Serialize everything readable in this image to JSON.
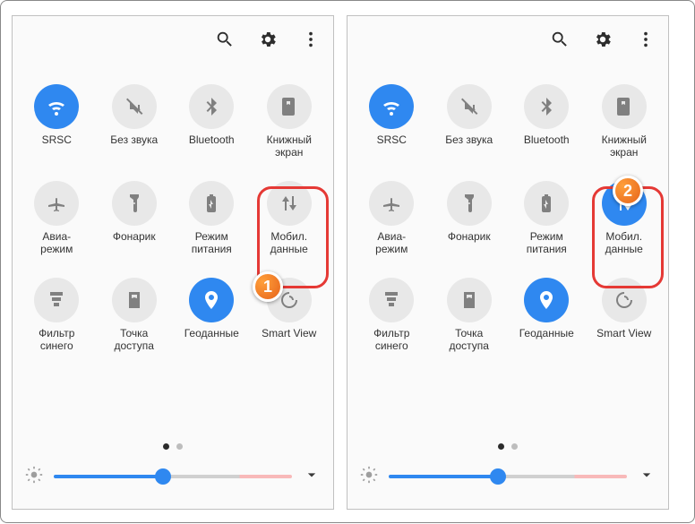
{
  "badges": {
    "left": "1",
    "right": "2"
  },
  "screens": [
    {
      "tiles": [
        {
          "name": "wifi",
          "label": "SRSC",
          "icon": "wifi",
          "on": true
        },
        {
          "name": "mute",
          "label": "Без звука",
          "icon": "mute",
          "on": false
        },
        {
          "name": "bluetooth",
          "label": "Bluetooth",
          "icon": "bluetooth",
          "on": false
        },
        {
          "name": "book",
          "label": "Книжный\nэкран",
          "icon": "book",
          "on": false
        },
        {
          "name": "airplane",
          "label": "Авиа-\nрежим",
          "icon": "airplane",
          "on": false
        },
        {
          "name": "flashlight",
          "label": "Фонарик",
          "icon": "flashlight",
          "on": false
        },
        {
          "name": "powersave",
          "label": "Режим\nпитания",
          "icon": "battery",
          "on": false
        },
        {
          "name": "mobiledata",
          "label": "Мобил.\nданные",
          "icon": "updown",
          "on": false
        },
        {
          "name": "bluefilter",
          "label": "Фильтр\nсинего",
          "icon": "bfilter",
          "on": false
        },
        {
          "name": "hotspot",
          "label": "Точка\nдоступа",
          "icon": "hotspot",
          "on": false
        },
        {
          "name": "location",
          "label": "Геоданные",
          "icon": "location",
          "on": true
        },
        {
          "name": "smartview",
          "label": "Smart View",
          "icon": "smartview",
          "on": false
        }
      ]
    },
    {
      "tiles": [
        {
          "name": "wifi",
          "label": "SRSC",
          "icon": "wifi",
          "on": true
        },
        {
          "name": "mute",
          "label": "Без звука",
          "icon": "mute",
          "on": false
        },
        {
          "name": "bluetooth",
          "label": "Bluetooth",
          "icon": "bluetooth",
          "on": false
        },
        {
          "name": "book",
          "label": "Книжный\nэкран",
          "icon": "book",
          "on": false
        },
        {
          "name": "airplane",
          "label": "Авиа-\nрежим",
          "icon": "airplane",
          "on": false
        },
        {
          "name": "flashlight",
          "label": "Фонарик",
          "icon": "flashlight",
          "on": false
        },
        {
          "name": "powersave",
          "label": "Режим\nпитания",
          "icon": "battery",
          "on": false
        },
        {
          "name": "mobiledata",
          "label": "Мобил.\nданные",
          "icon": "updown",
          "on": true
        },
        {
          "name": "bluefilter",
          "label": "Фильтр\nсинего",
          "icon": "bfilter",
          "on": false
        },
        {
          "name": "hotspot",
          "label": "Точка\nдоступа",
          "icon": "hotspot",
          "on": false
        },
        {
          "name": "location",
          "label": "Геоданные",
          "icon": "location",
          "on": true
        },
        {
          "name": "smartview",
          "label": "Smart View",
          "icon": "smartview",
          "on": false
        }
      ]
    }
  ],
  "pager": {
    "pages": 2,
    "active": 0
  },
  "brightness": {
    "value": 46
  }
}
